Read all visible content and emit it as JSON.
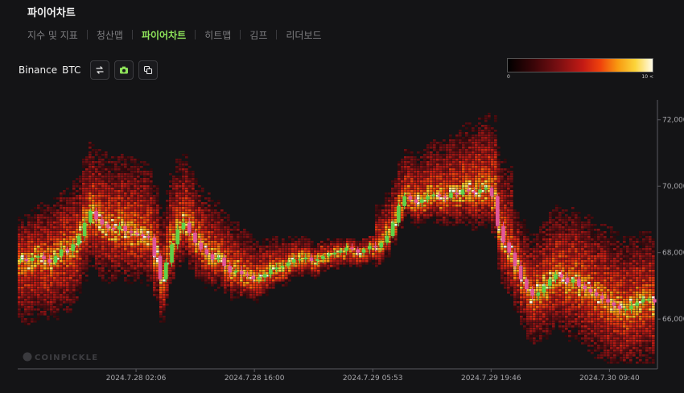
{
  "page": {
    "title": "파이어차트"
  },
  "tabs": [
    {
      "label": "지수 및 지표",
      "active": false
    },
    {
      "label": "청산맵",
      "active": false
    },
    {
      "label": "파이어차트",
      "active": true
    },
    {
      "label": "히트맵",
      "active": false
    },
    {
      "label": "김프",
      "active": false
    },
    {
      "label": "리더보드",
      "active": false
    }
  ],
  "toolbar": {
    "exchange": "Binance",
    "symbol": "BTC",
    "icons": [
      "refresh-icon",
      "camera-icon",
      "copy-icon"
    ]
  },
  "legend": {
    "min_label": "0",
    "max_label": "10 <"
  },
  "colors": {
    "accent": "#8ee35a",
    "candle_up": "#5fd14a",
    "candle_down": "#e0569a",
    "heat_low": "#3b0508",
    "heat_high": "#fffbe8"
  },
  "chart_data": {
    "type": "heatmap",
    "title": "",
    "watermark": "COINPICKLE",
    "x_ticks": [
      "2024.7.28 02:06",
      "2024.7.28 16:00",
      "2024.7.29 05:53",
      "2024.7.29 19:46",
      "2024.7.30 09:40"
    ],
    "y_ticks": [
      "72,000",
      "70,000",
      "68,000",
      "66,000"
    ],
    "y_tick_values": [
      72000,
      70000,
      68000,
      66000
    ],
    "ylim": [
      64500,
      72600
    ],
    "price_series": [
      67800,
      67750,
      67850,
      67900,
      67800,
      67700,
      67900,
      68100,
      68050,
      68250,
      68500,
      68900,
      69250,
      69000,
      68850,
      68750,
      68700,
      68800,
      68650,
      68600,
      68550,
      68500,
      68450,
      67900,
      67200,
      67700,
      68250,
      68700,
      68900,
      68600,
      68300,
      68100,
      67950,
      67800,
      67850,
      67600,
      67400,
      67450,
      67350,
      67300,
      67200,
      67250,
      67350,
      67500,
      67550,
      67600,
      67700,
      67800,
      67800,
      67850,
      67750,
      67800,
      67900,
      67950,
      68000,
      68050,
      68150,
      68100,
      68000,
      68100,
      68200,
      68150,
      68300,
      68500,
      68900,
      69400,
      69700,
      69600,
      69500,
      69600,
      69700,
      69750,
      69700,
      69650,
      69800,
      69750,
      69900,
      69850,
      69800,
      69900,
      69950,
      69700,
      68800,
      68300,
      68000,
      67600,
      67200,
      66900,
      66700,
      66800,
      67000,
      67200,
      67350,
      67250,
      67100,
      67200,
      67000,
      66900,
      66800,
      66700,
      66600,
      66500,
      66400,
      66300,
      66300,
      66400,
      66500,
      66600,
      66600,
      66500
    ]
  }
}
